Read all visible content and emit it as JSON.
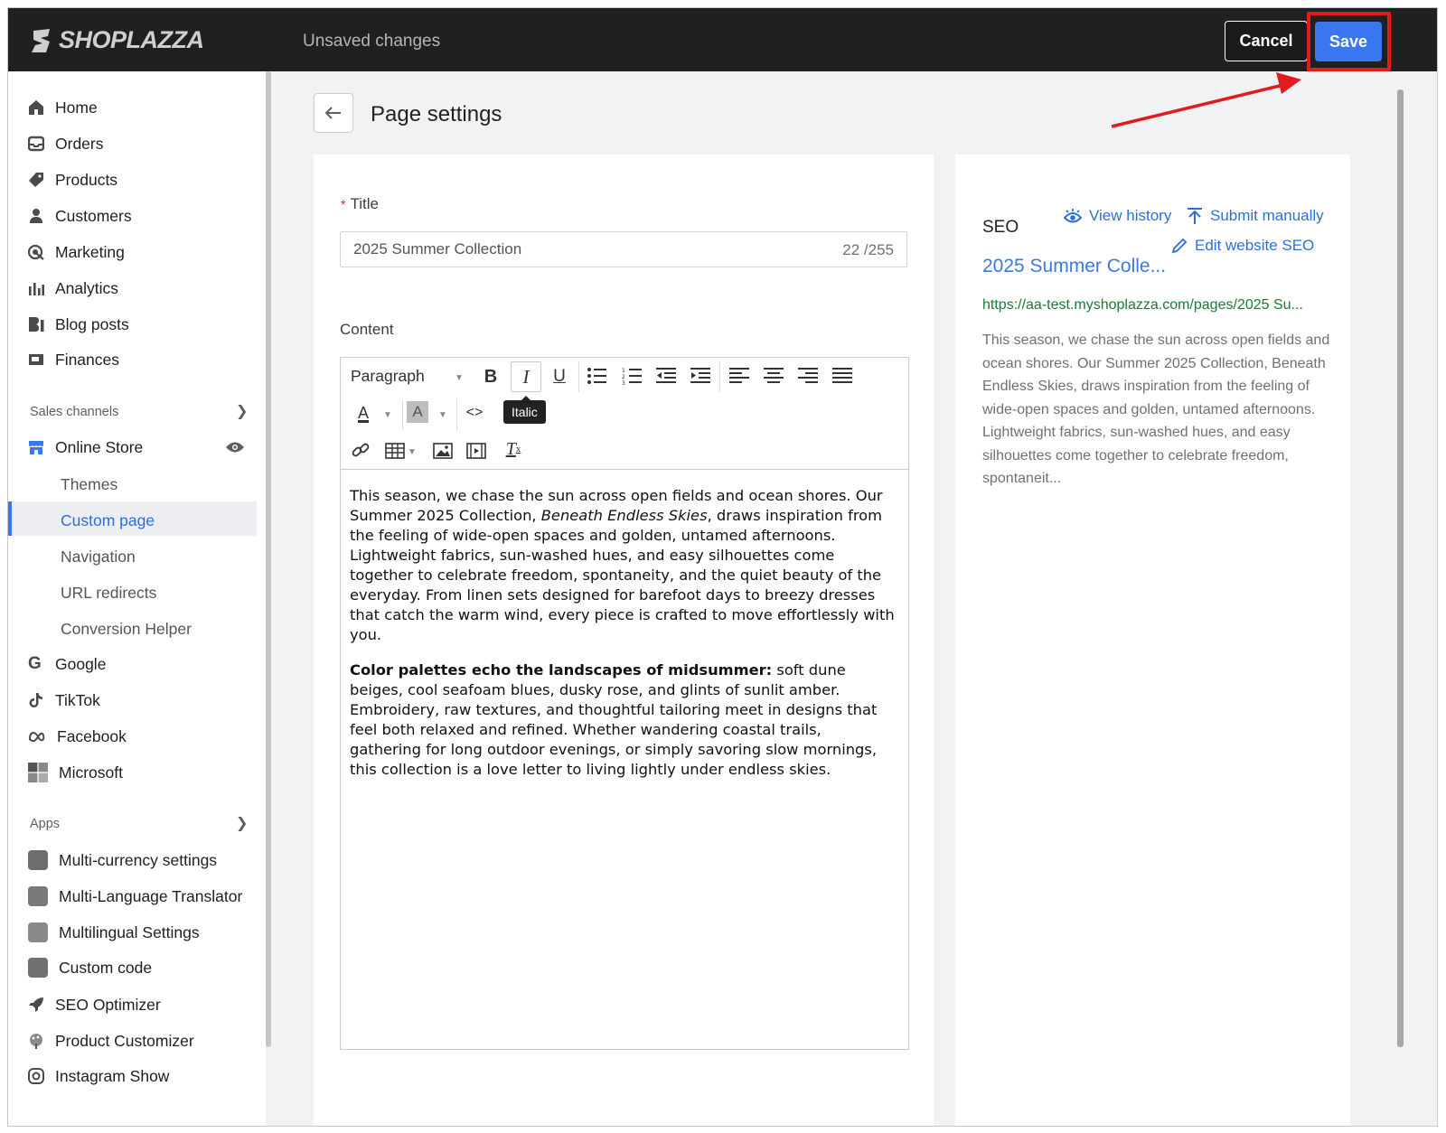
{
  "topbar": {
    "brand": "SHOPLAZZA",
    "status": "Unsaved changes",
    "cancel_label": "Cancel",
    "save_label": "Save",
    "highlight_color": "#e01c1c"
  },
  "sidebar": {
    "items": [
      {
        "label": "Home",
        "icon": "home-icon"
      },
      {
        "label": "Orders",
        "icon": "orders-icon"
      },
      {
        "label": "Products",
        "icon": "tag-icon"
      },
      {
        "label": "Customers",
        "icon": "person-icon"
      },
      {
        "label": "Marketing",
        "icon": "marketing-icon"
      },
      {
        "label": "Analytics",
        "icon": "bar-chart-icon"
      },
      {
        "label": "Blog posts",
        "icon": "blog-icon"
      },
      {
        "label": "Finances",
        "icon": "finances-icon"
      }
    ],
    "sales_channels_label": "Sales channels",
    "online_store": "Online Store",
    "online_store_sub": [
      "Themes",
      "Custom page",
      "Navigation",
      "URL redirects",
      "Conversion Helper"
    ],
    "channels": [
      "Google",
      "TikTok",
      "Facebook",
      "Microsoft"
    ],
    "apps_label": "Apps",
    "apps": [
      "Multi-currency settings",
      "Multi-Language Translator",
      "Multilingual Settings",
      "Custom code",
      "SEO Optimizer",
      "Product Customizer",
      "Instagram Show"
    ]
  },
  "page": {
    "title": "Page settings",
    "title_label": "Title",
    "title_value": "2025 Summer Collection",
    "title_counter": "22 /255",
    "content_label": "Content",
    "toolbar": {
      "paragraph": "Paragraph",
      "tooltip": "Italic"
    },
    "content": {
      "p1_a": "This season, we chase the sun across open fields and ocean shores. Our Summer 2025 Collection, ",
      "p1_em": "Beneath Endless Skies",
      "p1_b": ", draws inspiration from the feeling of wide-open spaces and golden, untamed afternoons. Lightweight fabrics, sun-washed hues, and easy silhouettes come together to celebrate freedom, spontaneity, and the quiet beauty of the everyday. From linen sets designed for barefoot days to breezy dresses that catch the warm wind, every piece is crafted to move effortlessly with you.",
      "p2_strong": "Color palettes echo the landscapes of midsummer:",
      "p2_b": " soft dune beiges, cool seafoam blues, dusky rose, and glints of sunlit amber. Embroidery, raw textures, and thoughtful tailoring meet in designs that feel both relaxed and refined. Whether wandering coastal trails, gathering for long outdoor evenings, or simply savoring slow mornings, this collection is a love letter to living lightly under endless skies."
    }
  },
  "seo": {
    "label": "SEO",
    "view_history": "View history",
    "submit_manually": "Submit manually",
    "edit_seo": "Edit website SEO",
    "preview_title": "2025 Summer Colle...",
    "preview_url": "https://aa-test.myshoplazza.com/pages/2025 Su...",
    "preview_desc": "This season, we chase the sun across open fields and ocean shores. Our Summer 2025 Collection, Beneath Endless Skies, draws inspiration from the feeling of wide-open spaces and golden, untamed afternoons. Lightweight fabrics, sun-washed hues, and easy silhouettes come together to celebrate freedom, spontaneit..."
  }
}
